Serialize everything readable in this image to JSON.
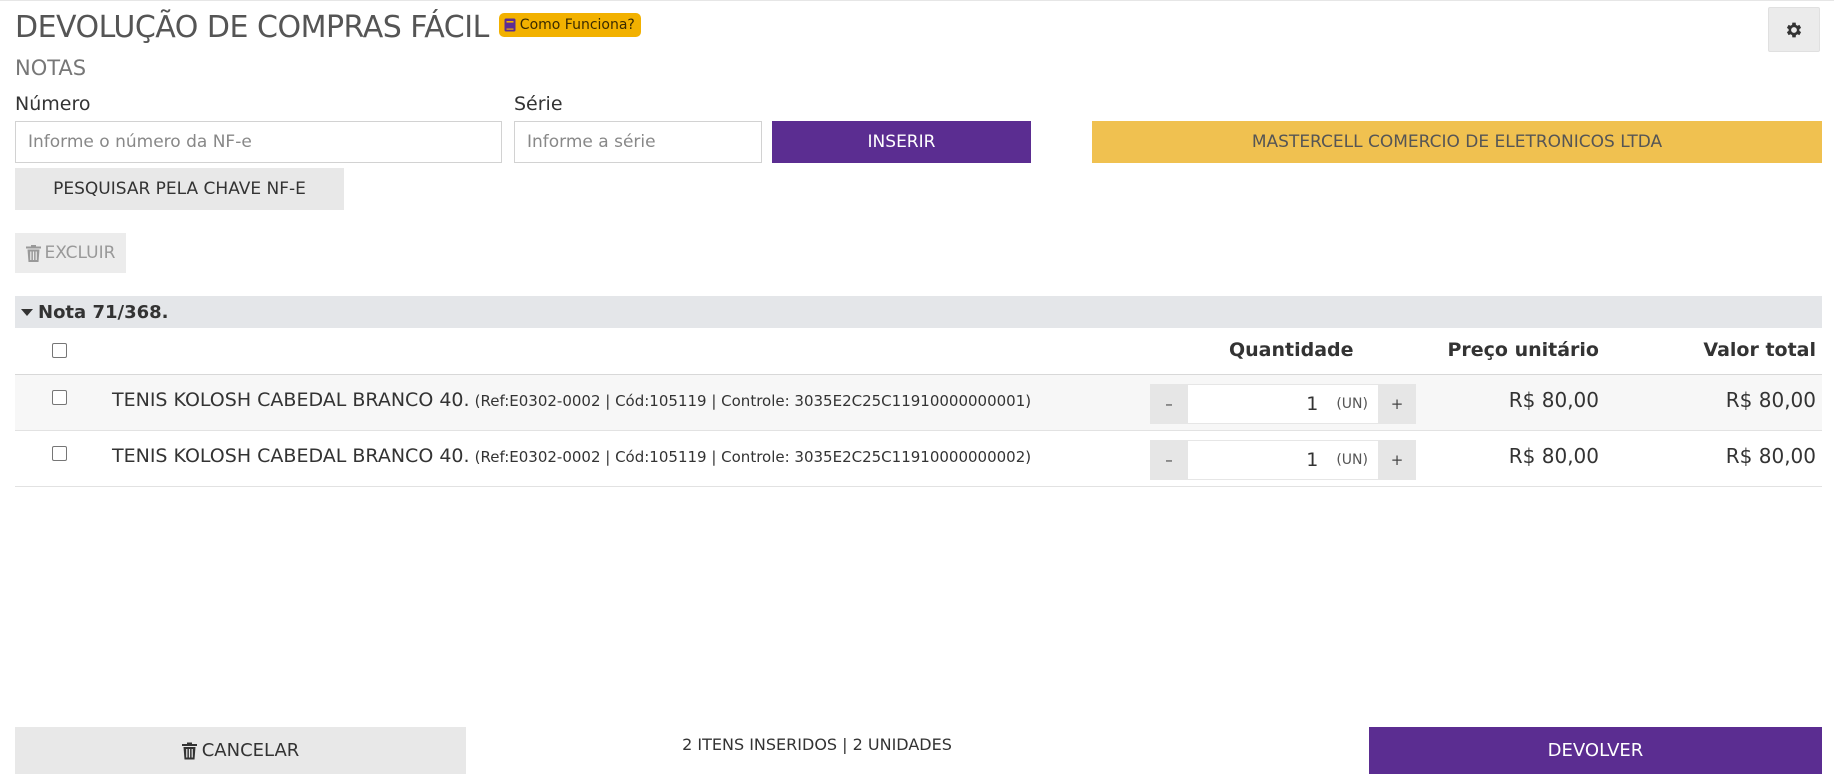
{
  "header": {
    "title": "DEVOLUÇÃO DE COMPRAS FÁCIL",
    "help_label": "Como Funciona?",
    "help_icon": "book-icon",
    "settings_icon": "gear-icon"
  },
  "notes": {
    "section_label": "NOTAS",
    "number_label": "Número",
    "number_placeholder": "Informe o número da NF-e",
    "number_value": "",
    "series_label": "Série",
    "series_placeholder": "Informe a série",
    "series_value": "",
    "insert_label": "INSERIR",
    "company_label": "MASTERCELL COMERCIO DE ELETRONICOS LTDA",
    "search_key_label": "PESQUISAR PELA CHAVE NF-E",
    "delete_label": "EXCLUIR"
  },
  "group": {
    "label": "Nota 71/368."
  },
  "table": {
    "columns": {
      "quantity": "Quantidade",
      "unit_price": "Preço unitário",
      "total": "Valor total"
    },
    "rows": [
      {
        "name": "TENIS KOLOSH CABEDAL BRANCO 40.",
        "meta": "(Ref:E0302-0002 | Cód:105119 | Controle: 3035E2C25C11910000000001)",
        "qty": "1",
        "unit": "(UN)",
        "unit_price": "R$ 80,00",
        "total": "R$ 80,00"
      },
      {
        "name": "TENIS KOLOSH CABEDAL BRANCO 40.",
        "meta": "(Ref:E0302-0002 | Cód:105119 | Controle: 3035E2C25C11910000000002)",
        "qty": "1",
        "unit": "(UN)",
        "unit_price": "R$ 80,00",
        "total": "R$ 80,00"
      }
    ],
    "minus_label": "–",
    "plus_label": "+"
  },
  "footer": {
    "cancel_label": "CANCELAR",
    "summary": "2 ITENS INSERIDOS | 2 UNIDADES",
    "return_label": "DEVOLVER"
  },
  "colors": {
    "primary": "#5b2d91",
    "company_bar": "#f0c150",
    "badge": "#f2b100",
    "group_header": "#e4e6e9"
  }
}
